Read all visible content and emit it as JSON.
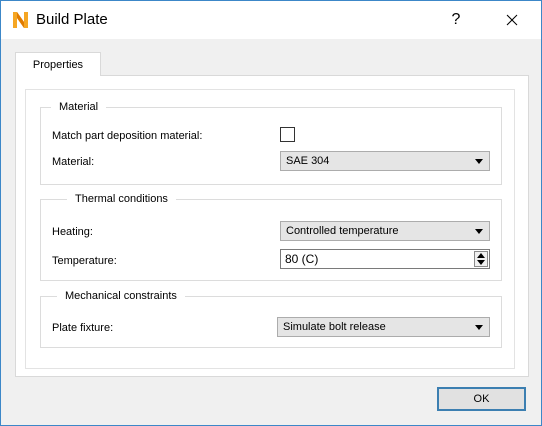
{
  "window": {
    "title": "Build Plate",
    "help_label": "?",
    "close_label": "✕"
  },
  "tabs": [
    {
      "label": "Properties"
    }
  ],
  "groups": {
    "material": {
      "title": "Material",
      "match_label": "Match part deposition material:",
      "match_checked": false,
      "material_label": "Material:",
      "material_value": "SAE 304"
    },
    "thermal": {
      "title": "Thermal conditions",
      "heating_label": "Heating:",
      "heating_value": "Controlled temperature",
      "temperature_label": "Temperature:",
      "temperature_value": "80 (C)"
    },
    "mechanical": {
      "title": "Mechanical constraints",
      "fixture_label": "Plate fixture:",
      "fixture_value": "Simulate bolt release"
    }
  },
  "footer": {
    "ok_label": "OK"
  },
  "colors": {
    "accent_border": "#3c7fb1",
    "icon_orange": "#f5a623"
  }
}
